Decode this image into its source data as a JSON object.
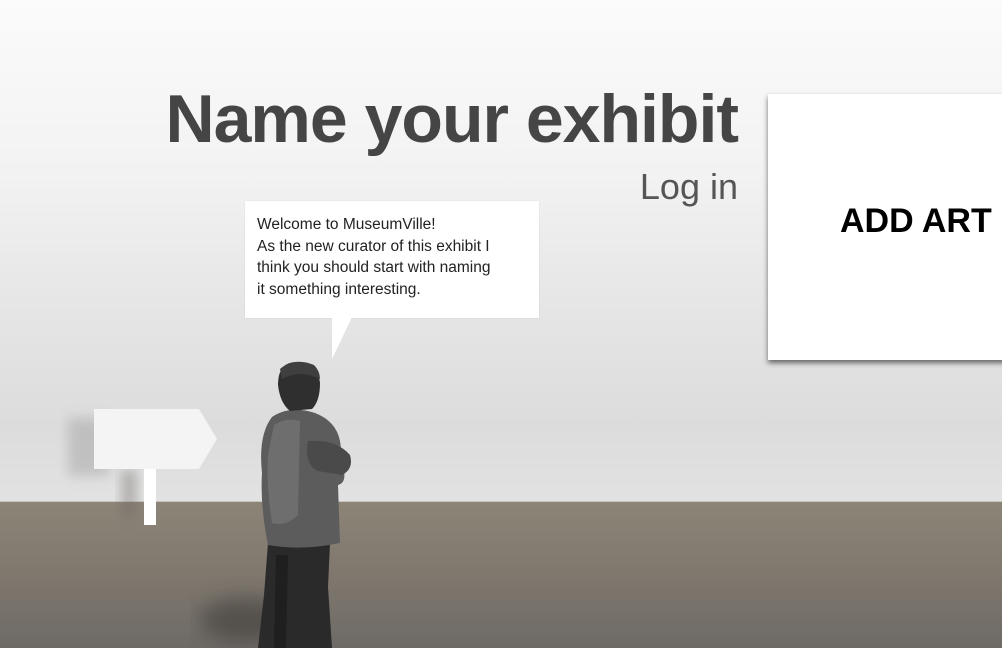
{
  "header": {
    "title": "Name your exhibit",
    "login_label": "Log in"
  },
  "guide": {
    "speech_lines": [
      "Welcome to MuseumVille!",
      "As the new curator of this exhibit I",
      "think you should start with naming",
      "it something interesting."
    ]
  },
  "gallery": {
    "add_art_label": "ADD ART"
  },
  "colors": {
    "title_text": "#454545",
    "wall": "#eeeeee",
    "floor": "#857d72",
    "panel": "#ffffff"
  }
}
